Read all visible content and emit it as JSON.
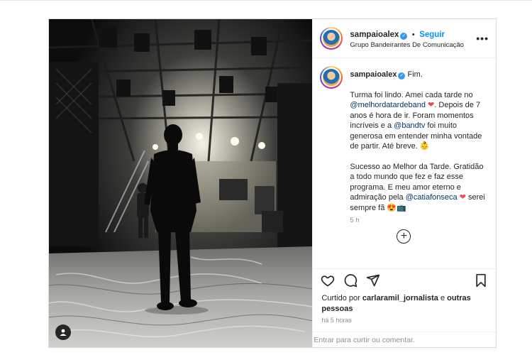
{
  "post": {
    "author": {
      "username": "sampaioalex",
      "follow_label": "Seguir",
      "separator": "•",
      "subtitle": "Grupo Bandeirantes De Comunicação",
      "verified": true
    },
    "more_icon": "more-horizontal-icon",
    "caption": {
      "username": "sampaioalex",
      "title": "Fim.",
      "p1_a": "Turma foi lindo. Amei cada tarde no ",
      "p1_mention1": "@melhordatardeband",
      "p1_b": " ",
      "p1_heart": "❤",
      "p1_c": ". Depois de 7 anos é hora de ir. Foram momentos incríveis e a ",
      "p1_mention2": "@bandtv",
      "p1_d": " foi muito generosa em entender minha vontade de partir. Até breve. ",
      "p1_emoji": "👶",
      "p2_a": "Sucesso ao Melhor da Tarde. Gratidão a todo mundo que fez e faz esse programa. E meu amor eterno e admiração pela ",
      "p2_mention": "@catiafonseca",
      "p2_b": " ",
      "p2_heart": "❤",
      "p2_c": " serei sempre fã ",
      "p2_emoji": "😍📺",
      "time": "5 h"
    },
    "load_more_icon": "plus-circle-icon",
    "actions": {
      "like_icon": "heart-icon",
      "comment_icon": "comment-icon",
      "share_icon": "send-icon",
      "save_icon": "bookmark-icon"
    },
    "likes": {
      "prefix": "Curtido por ",
      "user": "carlaramil_jornalista",
      "middle": " e ",
      "others": "outras pessoas"
    },
    "posted_time": "há 5 horas",
    "comment_placeholder": "Entrar para curtir ou comentar.",
    "colors": {
      "accent": "#0095f6",
      "mention": "#00376b",
      "heart": "#ed4956",
      "verified": "#3897f0"
    }
  }
}
